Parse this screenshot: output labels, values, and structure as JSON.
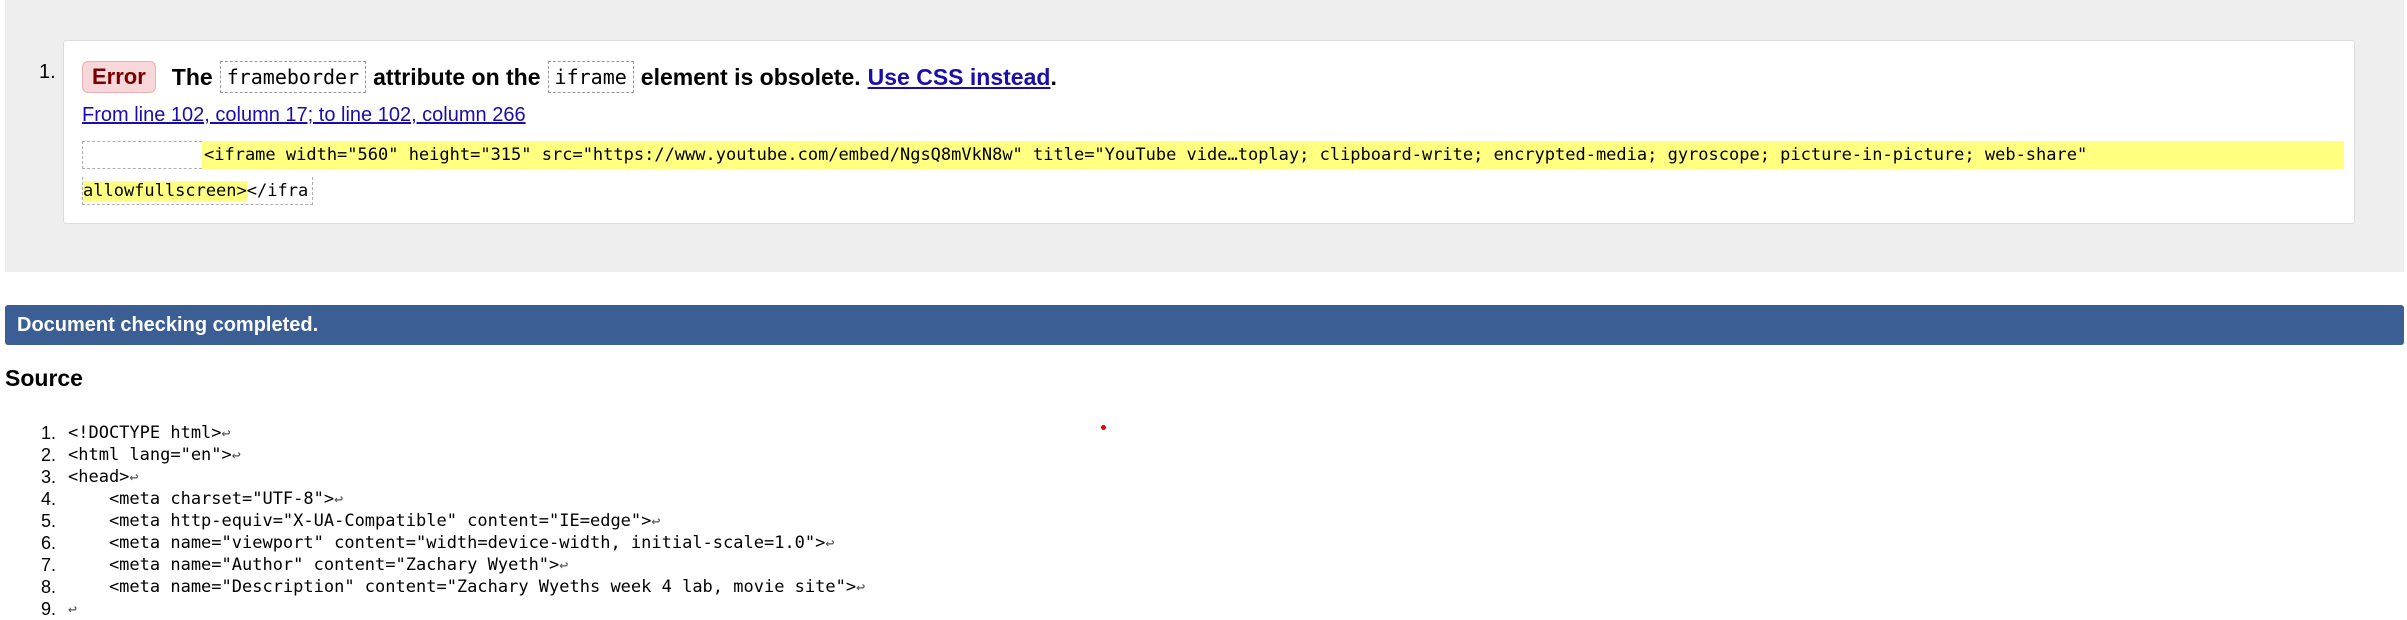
{
  "message": {
    "number": "1.",
    "type_label": "Error",
    "text_the": "The",
    "attribute_name": "frameborder",
    "text_attribute_on": "attribute on the",
    "element_name": "iframe",
    "text_obsolete": "element is obsolete.",
    "link_label": "Use CSS instead",
    "period": ".",
    "location": "From line 102, column 17; to line 102, column 266",
    "extract_line1": "<iframe width=\"560\" height=\"315\" src=\"https://www.youtube.com/embed/NgsQ8mVkN8w\" title=\"YouTube vide…toplay; clipboard-write; encrypted-media; gyroscope; picture-in-picture; web-share\"",
    "extract_line2_highlight": "allowfullscreen>",
    "extract_line2_rest": "</ifra"
  },
  "status": {
    "text": "Document checking completed."
  },
  "source": {
    "heading": "Source",
    "return_glyph": "↩",
    "lines": [
      {
        "num": "1.",
        "code": "<!DOCTYPE html>"
      },
      {
        "num": "2.",
        "code": "<html lang=\"en\">"
      },
      {
        "num": "3.",
        "code": "<head>"
      },
      {
        "num": "4.",
        "code": "    <meta charset=\"UTF-8\">"
      },
      {
        "num": "5.",
        "code": "    <meta http-equiv=\"X-UA-Compatible\" content=\"IE=edge\">"
      },
      {
        "num": "6.",
        "code": "    <meta name=\"viewport\" content=\"width=device-width, initial-scale=1.0\">"
      },
      {
        "num": "7.",
        "code": "    <meta name=\"Author\" content=\"Zachary Wyeth\">"
      },
      {
        "num": "8.",
        "code": "    <meta name=\"Description\" content=\"Zachary Wyeths week 4 lab, movie site\">"
      },
      {
        "num": "9.",
        "code": ""
      }
    ]
  },
  "colors": {
    "status_bar": "#3b5e95",
    "error_badge": "#f8d7da",
    "highlight": "#ffff80",
    "link": "#1a0dab"
  }
}
